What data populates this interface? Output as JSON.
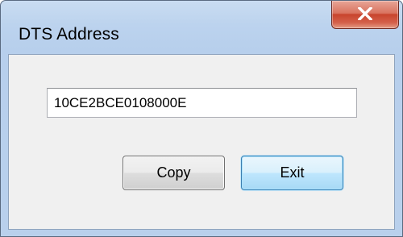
{
  "window": {
    "title": "DTS Address"
  },
  "titlebar": {
    "close_icon": "close-x-icon",
    "close_color": "#c8442d"
  },
  "form": {
    "address_value": "10CE2BCE0108000E"
  },
  "buttons": {
    "copy_label": "Copy",
    "exit_label": "Exit"
  }
}
